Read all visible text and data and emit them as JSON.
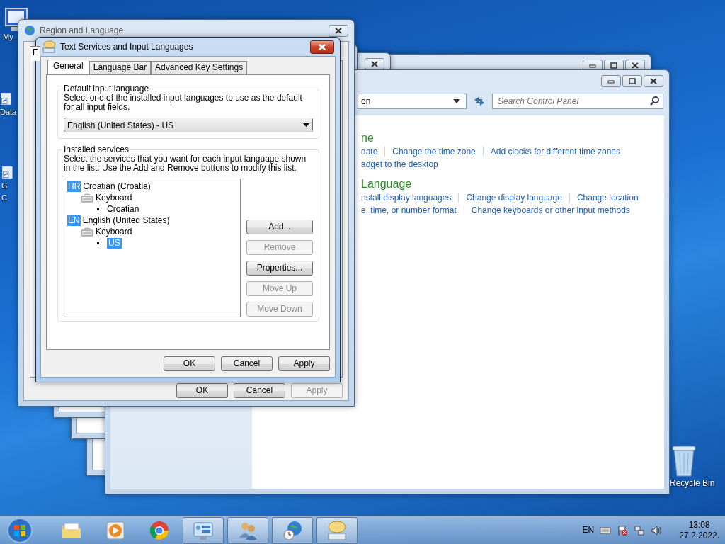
{
  "desktop_icons": [
    {
      "kind": "computer",
      "lines": [
        "My"
      ]
    },
    {
      "kind": "shortcut",
      "lines": [
        "Data"
      ]
    },
    {
      "kind": "shortcut",
      "lines": [
        "G",
        "C"
      ]
    }
  ],
  "recycle_bin": {
    "label": "Recycle Bin"
  },
  "control_panel": {
    "address": "on",
    "search_placeholder": "Search Control Panel",
    "sections": [
      {
        "title": "ne",
        "rows": [
          [
            "date",
            "Change the time zone",
            "Add clocks for different time zones"
          ],
          [
            "adget to the desktop"
          ]
        ]
      },
      {
        "title": "Language",
        "rows": [
          [
            "nstall display languages",
            "Change display language",
            "Change location"
          ],
          [
            "e, time, or number format",
            "Change keyboards or other input methods"
          ]
        ]
      }
    ]
  },
  "region_window": {
    "title": "Region and Language",
    "tab_stub": "F",
    "buttons": [
      {
        "label": "OK",
        "disabled": false
      },
      {
        "label": "Cancel",
        "disabled": false
      },
      {
        "label": "Apply",
        "disabled": true
      }
    ]
  },
  "dialog": {
    "title": "Text Services and Input Languages",
    "tabs": [
      {
        "label": "General",
        "selected": true
      },
      {
        "label": "Language Bar",
        "selected": false
      },
      {
        "label": "Advanced Key Settings",
        "selected": false
      }
    ],
    "default_group": {
      "title": "Default input language",
      "description": "Select one of the installed input languages to use as the default for all input fields.",
      "value": "English (United States) - US"
    },
    "services_group": {
      "title": "Installed services",
      "description": "Select the services that you want for each input language shown in the list. Use the Add and Remove buttons to modify this list.",
      "tree": [
        {
          "kind": "language",
          "badge": "HR",
          "label": "Croatian (Croatia)",
          "selected": false,
          "children": [
            {
              "kind": "input_type",
              "label": "Keyboard",
              "selected": false,
              "children": [
                {
                  "kind": "layout",
                  "label": "Croatian",
                  "selected": false
                }
              ]
            }
          ]
        },
        {
          "kind": "language",
          "badge": "EN",
          "label": "English (United States)",
          "selected": false,
          "children": [
            {
              "kind": "input_type",
              "label": "Keyboard",
              "selected": false,
              "children": [
                {
                  "kind": "layout",
                  "label": "US",
                  "selected": true
                }
              ]
            }
          ]
        }
      ],
      "side_buttons": [
        {
          "label": "Add...",
          "disabled": false
        },
        {
          "label": "Remove",
          "disabled": true
        },
        {
          "label": "Properties...",
          "disabled": false
        },
        {
          "label": "Move Up",
          "disabled": true
        },
        {
          "label": "Move Down",
          "disabled": true
        }
      ]
    },
    "buttons": [
      {
        "label": "OK",
        "disabled": false
      },
      {
        "label": "Cancel",
        "disabled": false
      },
      {
        "label": "Apply",
        "disabled": false
      }
    ]
  },
  "taskbar": {
    "items": [
      {
        "kind": "explorer",
        "open": false
      },
      {
        "kind": "media",
        "open": false
      },
      {
        "kind": "browser",
        "open": false
      },
      {
        "kind": "control_panel",
        "open": true
      },
      {
        "kind": "users",
        "open": true
      },
      {
        "kind": "region",
        "open": true
      },
      {
        "kind": "text_services",
        "open": true
      }
    ],
    "language": "EN",
    "time": "13:08",
    "date": "27.2.2022."
  }
}
